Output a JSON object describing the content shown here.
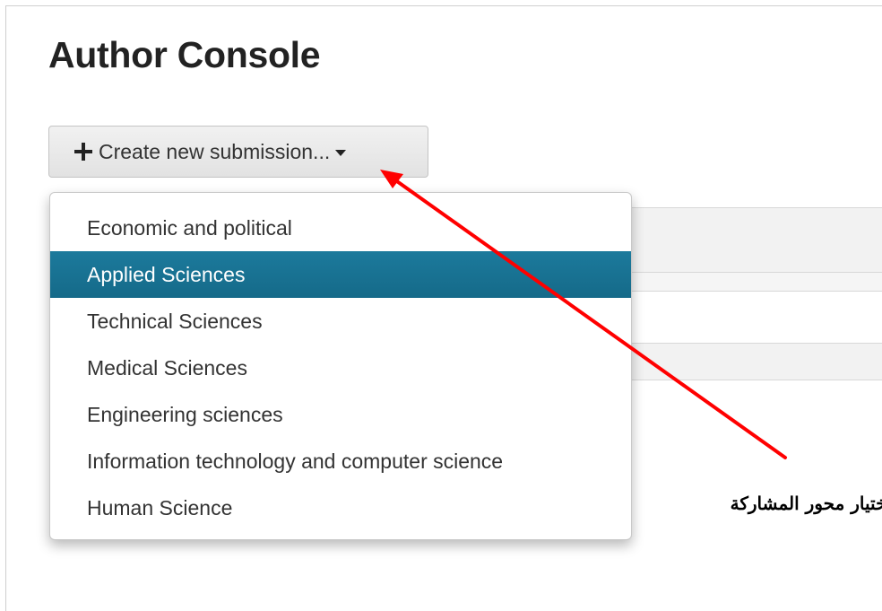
{
  "page": {
    "title": "Author Console"
  },
  "create_button": {
    "label": "Create new submission..."
  },
  "dropdown": {
    "items": [
      {
        "label": "Economic and political"
      },
      {
        "label": "Applied Sciences",
        "highlighted": true
      },
      {
        "label": "Technical Sciences"
      },
      {
        "label": "Medical Sciences"
      },
      {
        "label": "Engineering sciences"
      },
      {
        "label": "Information technology and computer science"
      },
      {
        "label": "Human Science"
      }
    ]
  },
  "annotation": {
    "text": "اختيار محور المشاركة"
  },
  "colors": {
    "highlight": "#1c7a9c",
    "arrow": "#ff0000"
  },
  "icons": {
    "create": "plus-icon",
    "dropdown": "caret-down-icon"
  }
}
